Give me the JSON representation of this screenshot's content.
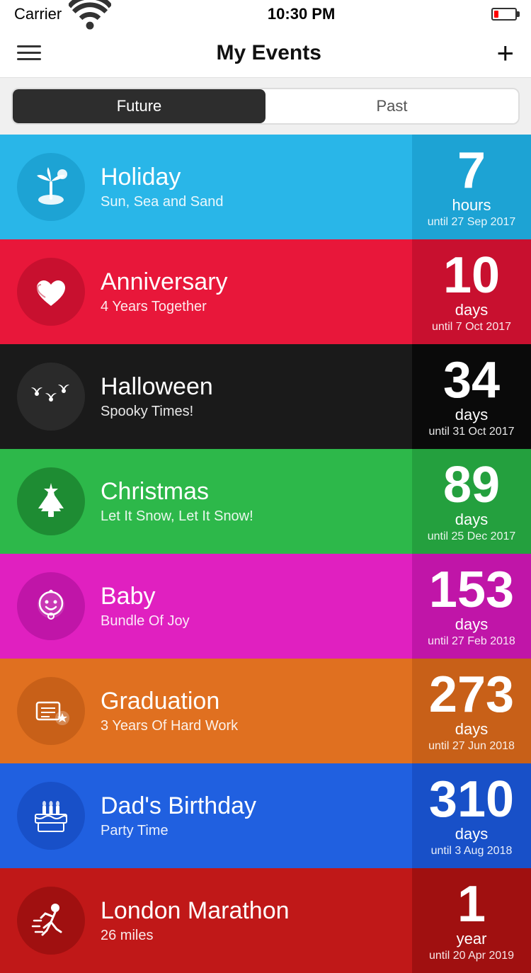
{
  "statusBar": {
    "carrier": "Carrier",
    "time": "10:30 PM",
    "wifi": true,
    "battery": "low"
  },
  "header": {
    "title": "My Events",
    "addLabel": "+"
  },
  "tabs": [
    {
      "id": "future",
      "label": "Future",
      "active": true
    },
    {
      "id": "past",
      "label": "Past",
      "active": false
    }
  ],
  "events": [
    {
      "id": "holiday",
      "title": "Holiday",
      "subtitle": "Sun, Sea and Sand",
      "icon": "palm",
      "colorClass": "row-holiday",
      "countNumber": "7",
      "countUnit": "hours",
      "countUntil": "until 27 Sep 2017"
    },
    {
      "id": "anniversary",
      "title": "Anniversary",
      "subtitle": "4 Years Together",
      "icon": "hearts",
      "colorClass": "row-anniversary",
      "countNumber": "10",
      "countUnit": "days",
      "countUntil": "until 7 Oct 2017"
    },
    {
      "id": "halloween",
      "title": "Halloween",
      "subtitle": "Spooky Times!",
      "icon": "bats",
      "colorClass": "row-halloween",
      "countNumber": "34",
      "countUnit": "days",
      "countUntil": "until 31 Oct 2017"
    },
    {
      "id": "christmas",
      "title": "Christmas",
      "subtitle": "Let It Snow, Let It Snow!",
      "icon": "tree",
      "colorClass": "row-christmas",
      "countNumber": "89",
      "countUnit": "days",
      "countUntil": "until 25 Dec 2017"
    },
    {
      "id": "baby",
      "title": "Baby",
      "subtitle": "Bundle Of Joy",
      "icon": "baby",
      "colorClass": "row-baby",
      "countNumber": "153",
      "countUnit": "days",
      "countUntil": "until 27 Feb 2018"
    },
    {
      "id": "graduation",
      "title": "Graduation",
      "subtitle": "3 Years Of Hard Work",
      "icon": "grad",
      "colorClass": "row-graduation",
      "countNumber": "273",
      "countUnit": "days",
      "countUntil": "until 27 Jun 2018"
    },
    {
      "id": "birthday",
      "title": "Dad's Birthday",
      "subtitle": "Party Time",
      "icon": "cake",
      "colorClass": "row-birthday",
      "countNumber": "310",
      "countUnit": "days",
      "countUntil": "until 3 Aug 2018"
    },
    {
      "id": "marathon",
      "title": "London Marathon",
      "subtitle": "26 miles",
      "icon": "runner",
      "colorClass": "row-marathon",
      "countNumber": "1",
      "countUnit": "year",
      "countUntil": "until 20 Apr 2019"
    }
  ]
}
